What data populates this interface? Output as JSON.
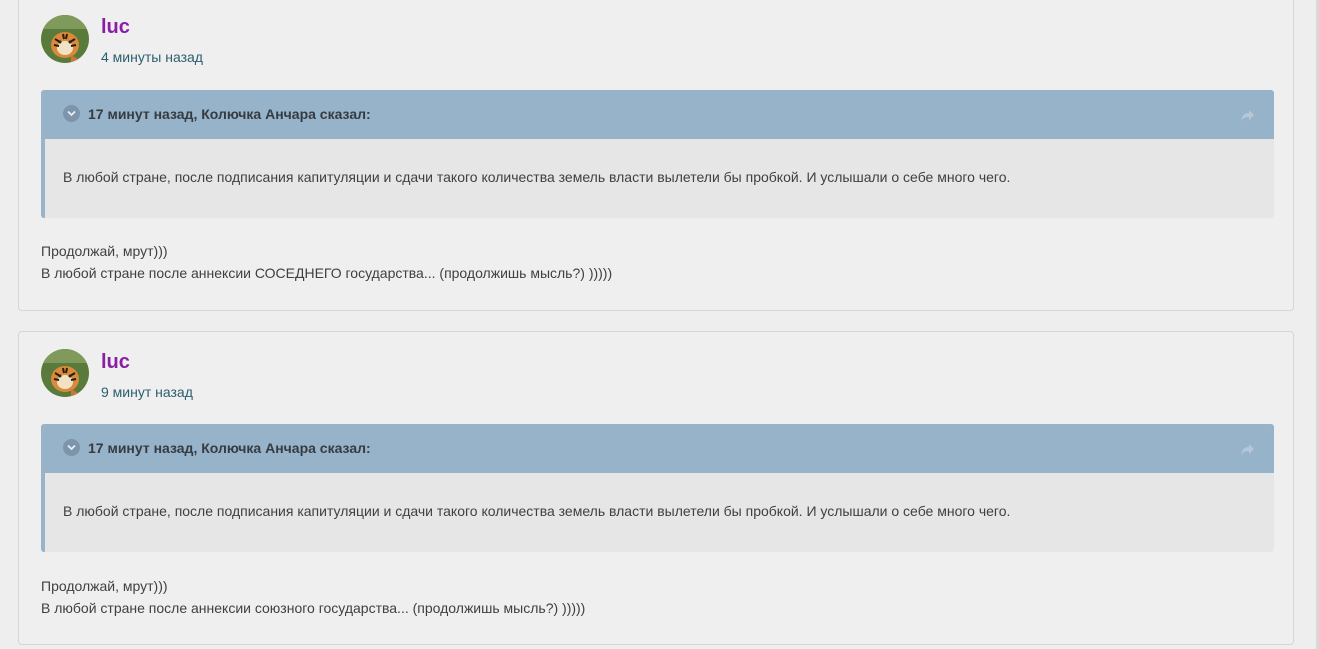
{
  "posts": [
    {
      "author": "luc",
      "time": "4 минуты назад",
      "quote": {
        "cite": "17 минут назад, Колючка Анчара сказал:",
        "text": "В любой стране, после подписания капитуляции и сдачи такого количества земель власти вылетели бы пробкой. И услышали о себе много чего."
      },
      "lines": [
        "Продолжай, мрут)))",
        "В любой стране после аннексии СОСЕДНЕГО государства... (продолжишь мысль?) )))))"
      ]
    },
    {
      "author": "luc",
      "time": "9 минут назад",
      "quote": {
        "cite": "17 минут назад, Колючка Анчара сказал:",
        "text": "В любой стране, после подписания капитуляции и сдачи такого количества земель власти вылетели бы пробкой. И услышали о себе много чего."
      },
      "lines": [
        "Продолжай, мрут)))",
        "В любой стране после аннексии союзного государства... (продолжишь мысль?) )))))"
      ]
    }
  ],
  "colors": {
    "author": "#8a1fa6",
    "time": "#2b5f6e",
    "quote_header": "#97b3ca",
    "quote_body": "#e6e6e6",
    "page_bg": "#eeeeee"
  },
  "icons": {
    "avatar": "tiger-avatar",
    "collapse": "chevron-down-icon",
    "share": "share-icon"
  }
}
